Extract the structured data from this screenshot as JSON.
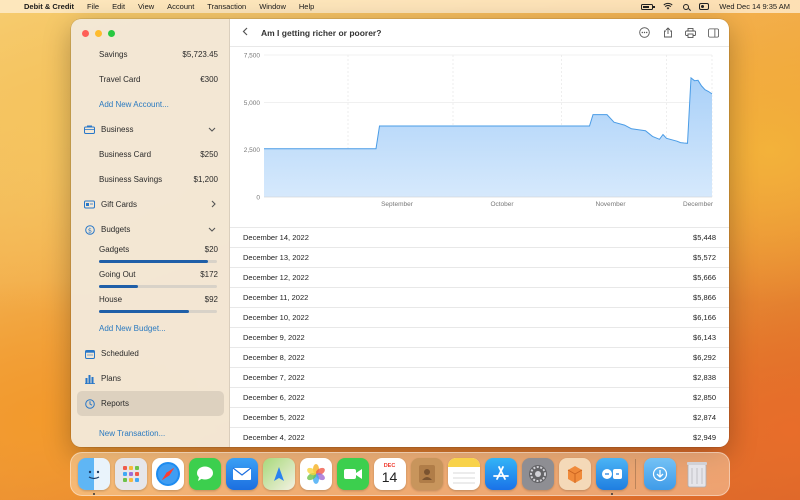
{
  "menubar": {
    "app_name": "Debit & Credit",
    "items": [
      "File",
      "Edit",
      "View",
      "Account",
      "Transaction",
      "Window",
      "Help"
    ],
    "datetime": "Wed Dec 14  9:35 AM",
    "status_icons": [
      "battery-icon",
      "wifi-icon",
      "search-icon",
      "control-center-icon"
    ]
  },
  "sidebar": {
    "accounts": [
      {
        "name": "Savings",
        "amount": "$5,723.45"
      },
      {
        "name": "Travel Card",
        "amount": "€300"
      }
    ],
    "add_account": "Add New Account...",
    "business": {
      "label": "Business",
      "icon": "briefcase-icon",
      "accounts": [
        {
          "name": "Business Card",
          "amount": "$250"
        },
        {
          "name": "Business Savings",
          "amount": "$1,200"
        }
      ]
    },
    "gift_cards": {
      "label": "Gift Cards",
      "icon": "gift-card-icon"
    },
    "budgets": {
      "label": "Budgets",
      "icon": "dollar-circle-icon",
      "items": [
        {
          "name": "Gadgets",
          "amount": "$20",
          "progress": 0.92
        },
        {
          "name": "Going Out",
          "amount": "$172",
          "progress": 0.33
        },
        {
          "name": "House",
          "amount": "$92",
          "progress": 0.76
        }
      ],
      "add_budget": "Add New Budget..."
    },
    "scheduled": {
      "label": "Scheduled",
      "icon": "calendar-icon"
    },
    "plans": {
      "label": "Plans",
      "icon": "bar-chart-icon"
    },
    "reports": {
      "label": "Reports",
      "icon": "clock-chart-icon"
    },
    "new_transaction": "New Transaction..."
  },
  "main": {
    "title": "Am I getting richer or poorer?",
    "toolbar_icons": [
      "more-icon",
      "share-icon",
      "print-icon",
      "sidebar-icon"
    ],
    "colors": {
      "accent": "#2a7ac0",
      "chart_fill": "#b9dafb",
      "chart_line": "#4a9ce6"
    }
  },
  "chart_data": {
    "type": "area",
    "xlabel": "",
    "ylabel": "",
    "ylim": [
      0,
      7500
    ],
    "yticks": [
      "7,500",
      "5,000",
      "2,500",
      "0"
    ],
    "ytick_values": [
      7500,
      5000,
      2500,
      0
    ],
    "xticks": [
      "September",
      "October",
      "November",
      "December"
    ],
    "grid": true,
    "points": [
      {
        "x": "2022-08-08",
        "y": 2550
      },
      {
        "x": "2022-09-09",
        "y": 2550
      },
      {
        "x": "2022-09-10",
        "y": 3750
      },
      {
        "x": "2022-11-09",
        "y": 3750
      },
      {
        "x": "2022-11-10",
        "y": 4350
      },
      {
        "x": "2022-11-14",
        "y": 4350
      },
      {
        "x": "2022-11-16",
        "y": 3950
      },
      {
        "x": "2022-11-19",
        "y": 3800
      },
      {
        "x": "2022-11-21",
        "y": 3600
      },
      {
        "x": "2022-11-25",
        "y": 3500
      },
      {
        "x": "2022-11-27",
        "y": 3200
      },
      {
        "x": "2022-11-29",
        "y": 3050
      },
      {
        "x": "2022-11-30",
        "y": 3300
      },
      {
        "x": "2022-12-01",
        "y": 3100
      },
      {
        "x": "2022-12-04",
        "y": 2949
      },
      {
        "x": "2022-12-05",
        "y": 2874
      },
      {
        "x": "2022-12-06",
        "y": 2850
      },
      {
        "x": "2022-12-07",
        "y": 2838
      },
      {
        "x": "2022-12-08",
        "y": 6292
      },
      {
        "x": "2022-12-09",
        "y": 6143
      },
      {
        "x": "2022-12-10",
        "y": 6166
      },
      {
        "x": "2022-12-11",
        "y": 5866
      },
      {
        "x": "2022-12-12",
        "y": 5666
      },
      {
        "x": "2022-12-13",
        "y": 5572
      },
      {
        "x": "2022-12-14",
        "y": 5448
      }
    ]
  },
  "transactions": [
    {
      "date": "December 14, 2022",
      "value": "$5,448"
    },
    {
      "date": "December 13, 2022",
      "value": "$5,572"
    },
    {
      "date": "December 12, 2022",
      "value": "$5,666"
    },
    {
      "date": "December 11, 2022",
      "value": "$5,866"
    },
    {
      "date": "December 10, 2022",
      "value": "$6,166"
    },
    {
      "date": "December 9, 2022",
      "value": "$6,143"
    },
    {
      "date": "December 8, 2022",
      "value": "$6,292"
    },
    {
      "date": "December 7, 2022",
      "value": "$2,838"
    },
    {
      "date": "December 6, 2022",
      "value": "$2,850"
    },
    {
      "date": "December 5, 2022",
      "value": "$2,874"
    },
    {
      "date": "December 4, 2022",
      "value": "$2,949"
    }
  ],
  "dock": {
    "calendar_month": "DEC",
    "calendar_day": "14",
    "apps": [
      "finder-icon",
      "launchpad-icon",
      "safari-icon",
      "messages-icon",
      "mail-icon",
      "maps-icon",
      "photos-icon",
      "facetime-icon",
      "calendar-icon",
      "contacts-icon",
      "notes-icon",
      "app-store-icon",
      "system-settings-icon",
      "debit-credit-icon",
      "screen-sharing-icon",
      "downloads-folder-icon",
      "trash-icon"
    ]
  }
}
